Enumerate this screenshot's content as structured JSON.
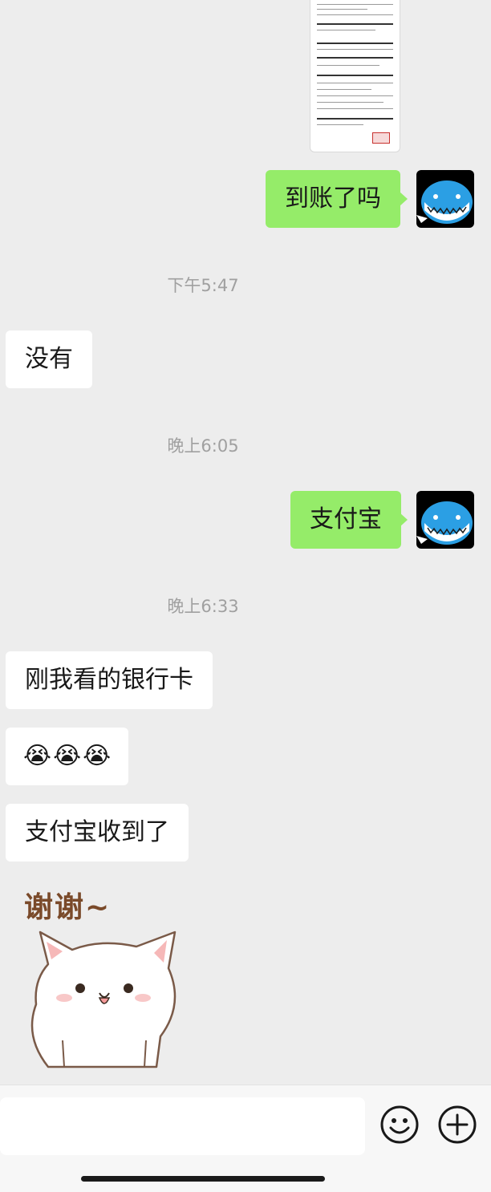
{
  "messages": {
    "m1": "到账了吗",
    "t1": "下午5:47",
    "m2": "没有",
    "t2": "晚上6:05",
    "m3": "支付宝",
    "t3": "晚上6:33",
    "m4": "刚我看的银行卡",
    "m5_emojis": [
      "😭",
      "😭",
      "😭"
    ],
    "m6": "支付宝收到了",
    "sticker_text": "谢谢~"
  },
  "input": {
    "value": ""
  },
  "colors": {
    "my_bubble": "#95ec69",
    "their_bubble": "#ffffff",
    "background": "#ededed",
    "avatar_whale": "#2b9fe4"
  },
  "icons": {
    "emoji_button": "smile-icon",
    "plus_button": "plus-circle-icon"
  }
}
